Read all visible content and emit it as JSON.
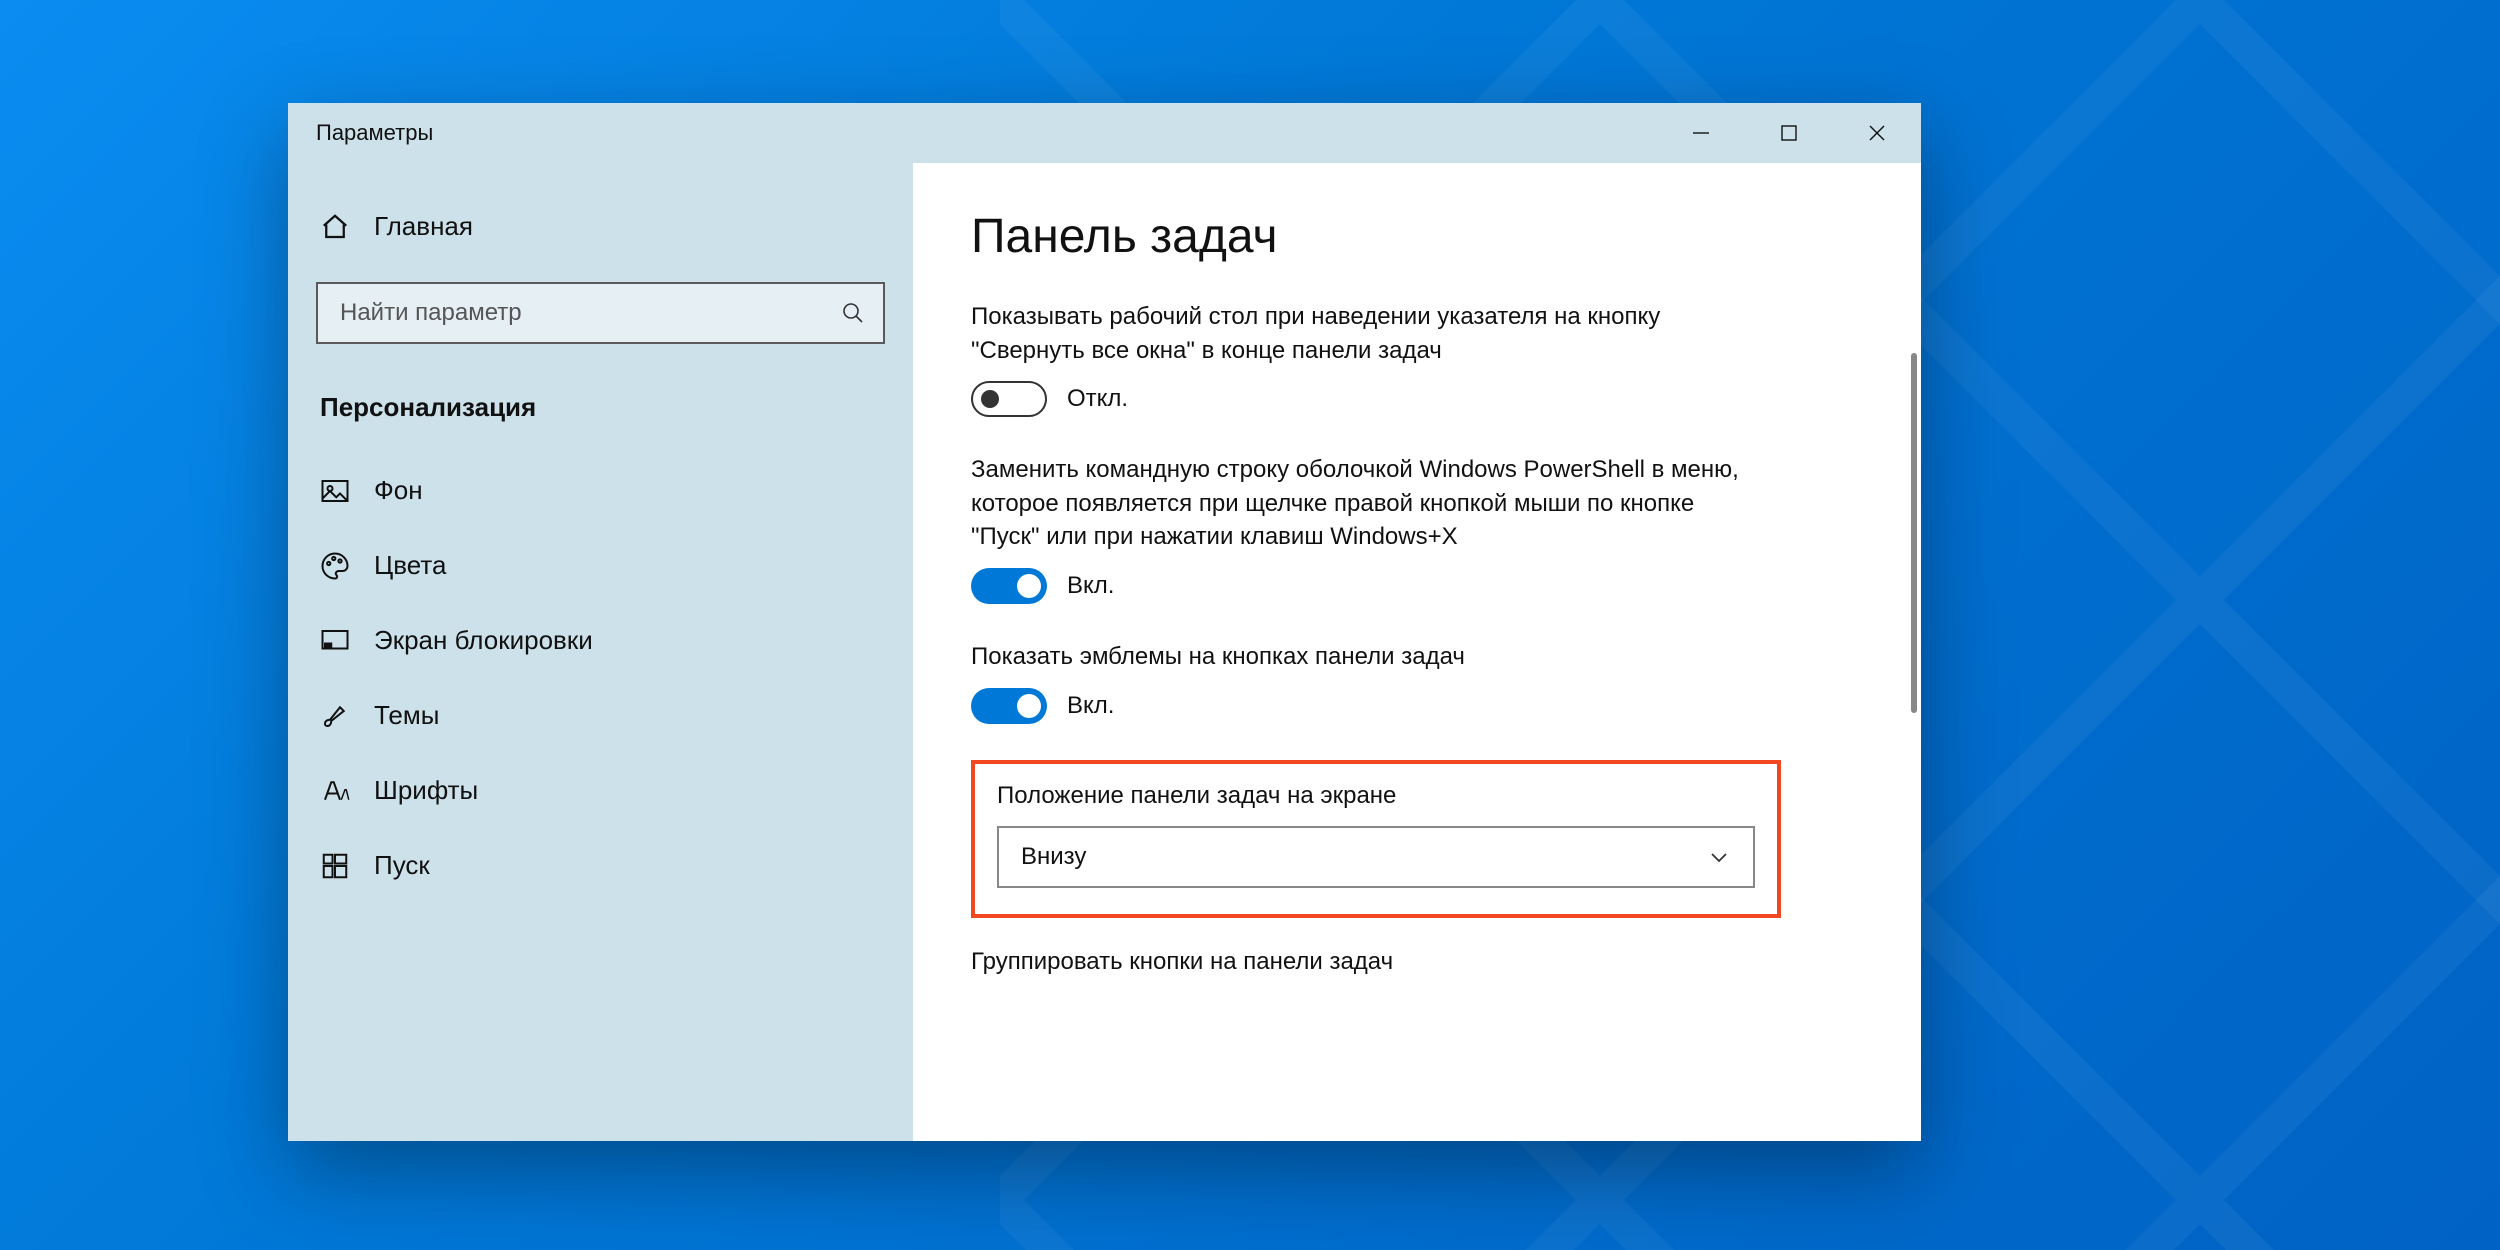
{
  "window": {
    "title": "Параметры"
  },
  "sidebar": {
    "home_label": "Главная",
    "search_placeholder": "Найти параметр",
    "section_heading": "Персонализация",
    "items": [
      {
        "label": "Фон"
      },
      {
        "label": "Цвета"
      },
      {
        "label": "Экран блокировки"
      },
      {
        "label": "Темы"
      },
      {
        "label": "Шрифты"
      },
      {
        "label": "Пуск"
      }
    ]
  },
  "main": {
    "page_title": "Панель задач",
    "settings": [
      {
        "desc": "Показывать рабочий стол при наведении указателя на кнопку \"Свернуть все окна\" в конце панели задач",
        "toggle_state": "off",
        "toggle_label": "Откл."
      },
      {
        "desc": "Заменить командную строку оболочкой Windows PowerShell в меню, которое появляется при щелчке правой кнопкой мыши по кнопке \"Пуск\" или при нажатии клавиш Windows+X",
        "toggle_state": "on",
        "toggle_label": "Вкл."
      },
      {
        "desc": "Показать эмблемы на кнопках панели задач",
        "toggle_state": "on",
        "toggle_label": "Вкл."
      }
    ],
    "dropdown_section": {
      "label": "Положение панели задач на экране",
      "value": "Внизу"
    },
    "next_label": "Группировать кнопки на панели задач"
  }
}
